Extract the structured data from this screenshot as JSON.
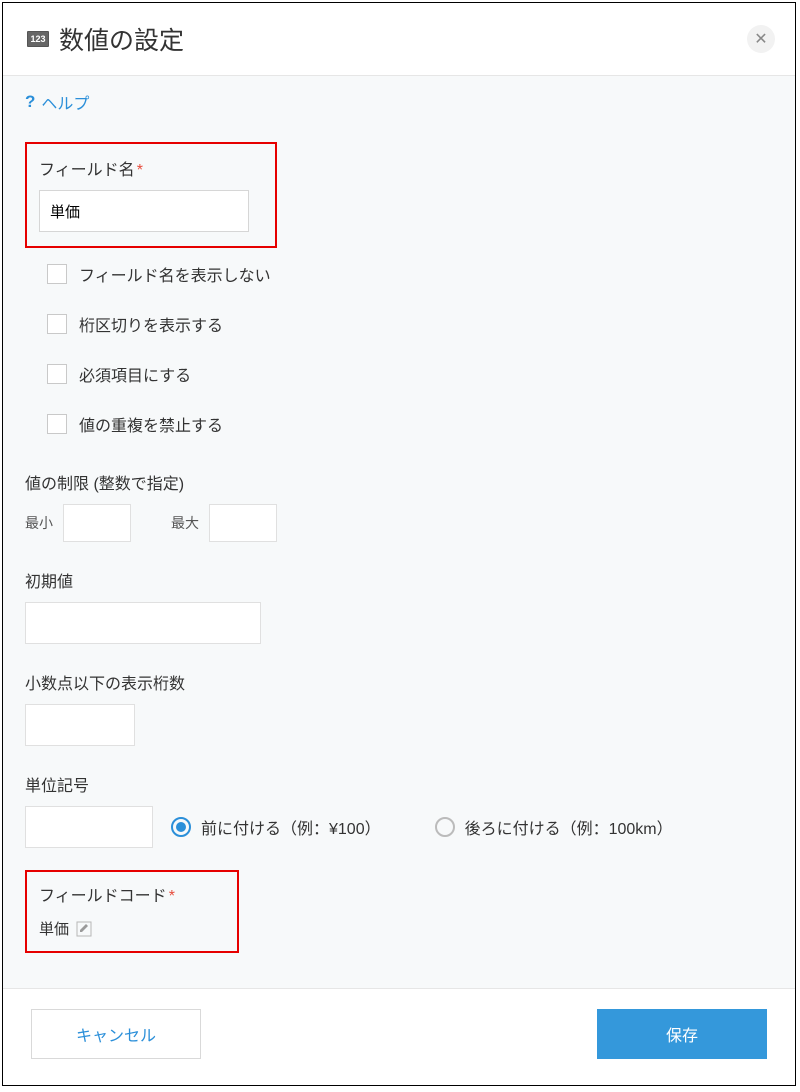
{
  "dialog": {
    "icon_text": "123",
    "title": "数値の設定"
  },
  "help": {
    "label": "ヘルプ"
  },
  "field_name": {
    "label": "フィールド名",
    "value": "単価"
  },
  "checkboxes": {
    "hide_name": "フィールド名を表示しない",
    "digit_sep": "桁区切りを表示する",
    "required": "必須項目にする",
    "unique": "値の重複を禁止する"
  },
  "range": {
    "label": "値の制限 (整数で指定)",
    "min_label": "最小",
    "min_value": "",
    "max_label": "最大",
    "max_value": ""
  },
  "default_value": {
    "label": "初期値",
    "value": ""
  },
  "decimals": {
    "label": "小数点以下の表示桁数",
    "value": ""
  },
  "unit": {
    "label": "単位記号",
    "value": "",
    "before_label": "前に付ける（例：¥100）",
    "after_label": "後ろに付ける（例：100km）"
  },
  "field_code": {
    "label": "フィールドコード",
    "value": "単価"
  },
  "footer": {
    "cancel": "キャンセル",
    "save": "保存"
  }
}
